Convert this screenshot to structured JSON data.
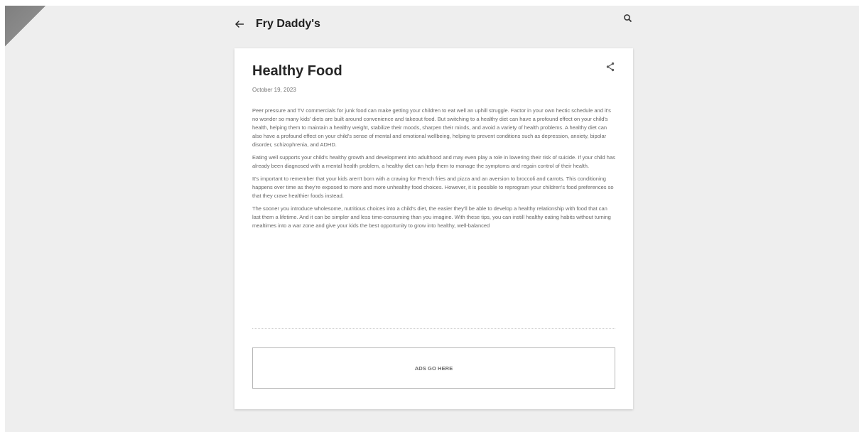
{
  "header": {
    "blog_title": "Fry Daddy's",
    "back_icon": "arrow-left-icon",
    "search_icon": "search-icon"
  },
  "post": {
    "title": "Healthy Food",
    "date": "October 19, 2023",
    "share_icon": "share-icon",
    "paragraphs": [
      " Peer pressure and TV commercials for junk food can make getting your children to eat well an uphill struggle. Factor in your own hectic schedule and it's no wonder so many kids' diets are built around convenience and takeout food. But switching to a healthy diet can have a profound effect on your child's health, helping them to maintain a healthy weight, stabilize their moods, sharpen their minds, and avoid a variety of health problems. A healthy diet can also have a profound effect on your child's sense of mental and emotional wellbeing, helping to prevent conditions such as depression, anxiety, bipolar disorder, schizophrenia, and ADHD.",
      "Eating well supports your child's healthy growth and development into adulthood and may even play a role in lowering their risk of suicide. If your child has already been diagnosed with a mental health problem, a healthy diet can help them to manage the symptoms and regain control of their health.",
      "It's important to remember that your kids aren't born with a craving for French fries and pizza and an aversion to broccoli and carrots. This conditioning happens over time as they're exposed to more and more unhealthy food choices. However, it is possible to reprogram your children's food preferences so that they crave healthier foods instead.",
      "The sooner you introduce wholesome, nutritious choices into a child's diet, the easier they'll be able to develop a healthy relationship with food that can last them a lifetime. And it can be simpler and less time-consuming than you imagine. With these tips, you can instill healthy eating habits without turning mealtimes into a war zone and give your kids the best opportunity to grow into healthy, well-balanced"
    ]
  },
  "ad": {
    "label": "ADS GO HERE"
  },
  "colors": {
    "background": "#eeeeee",
    "card": "#ffffff",
    "title_text": "#212121",
    "body_text": "#666666",
    "corner": "#888888"
  }
}
